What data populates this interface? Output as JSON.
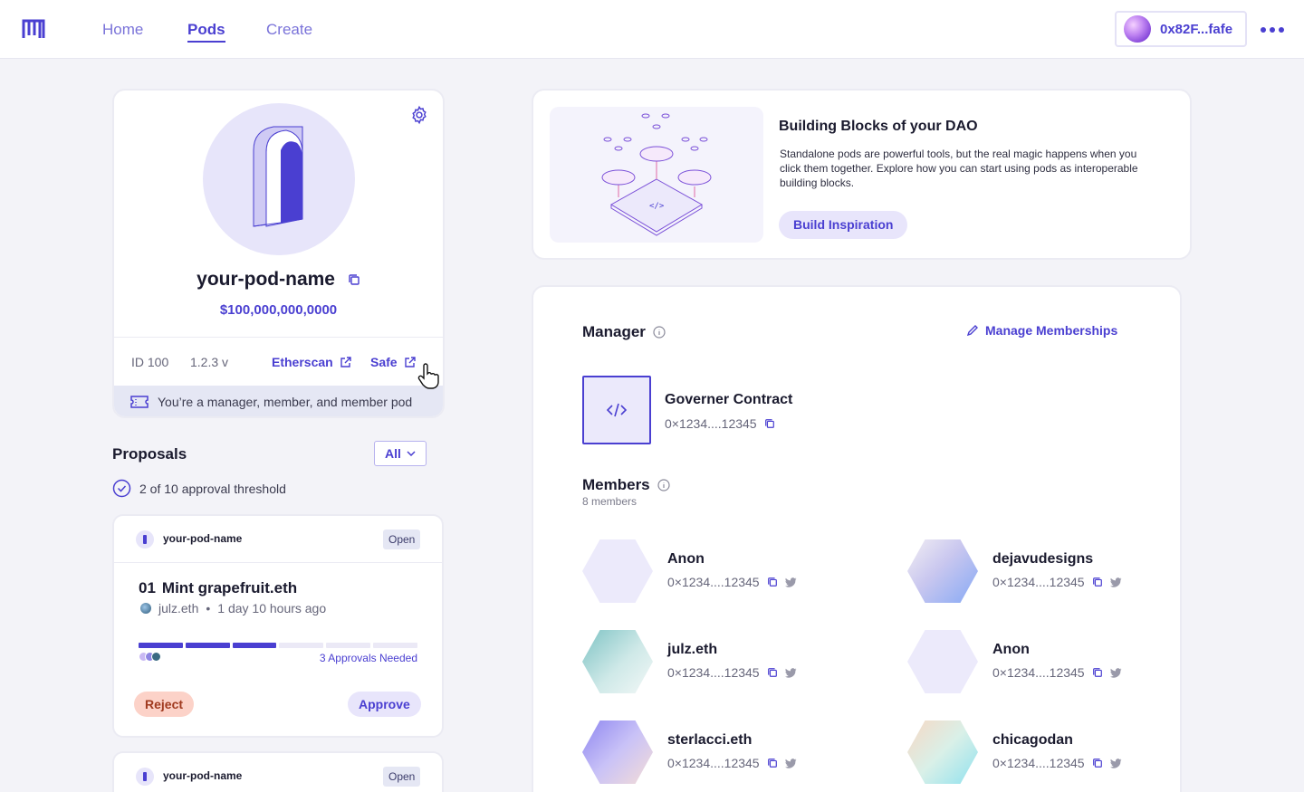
{
  "nav": {
    "links": [
      "Home",
      "Pods",
      "Create"
    ],
    "active": "Pods",
    "wallet_address": "0x82F...fafe"
  },
  "pod": {
    "name": "your-pod-name",
    "value": "$100,000,000,0000",
    "id_label": "ID 100",
    "version": "1.2.3 v",
    "etherscan_label": "Etherscan",
    "safe_label": "Safe",
    "role_text": "You’re a manager, member, and member pod"
  },
  "proposals": {
    "title": "Proposals",
    "filter_value": "All",
    "threshold_text": "2 of 10 approval threshold",
    "items": [
      {
        "pod_name": "your-pod-name",
        "status": "Open",
        "number": "01",
        "title": "Mint grapefruit.eth",
        "author": "julz.eth",
        "time_ago": "1 day 10 hours ago",
        "approvals_needed": "3 Approvals Needed",
        "progress_filled": 3,
        "progress_total": 6,
        "reject_label": "Reject",
        "approve_label": "Approve"
      },
      {
        "pod_name": "your-pod-name",
        "status": "Open"
      }
    ]
  },
  "blocks": {
    "title": "Building Blocks of your DAO",
    "description": "Standalone pods are powerful tools, but the real magic happens when you click them together. Explore how you can start using pods as interoperable building blocks.",
    "button_label": "Build Inspiration"
  },
  "manager": {
    "title": "Manager",
    "manage_label": "Manage Memberships",
    "contract_name": "Governer Contract",
    "contract_address": "0×1234....12345"
  },
  "members": {
    "title": "Members",
    "count_text": "8 members",
    "items": [
      {
        "name": "Anon",
        "address": "0×1234....12345"
      },
      {
        "name": "dejavudesigns",
        "address": "0×1234....12345"
      },
      {
        "name": "julz.eth",
        "address": "0×1234....12345"
      },
      {
        "name": "Anon",
        "address": "0×1234....12345"
      },
      {
        "name": "sterlacci.eth",
        "address": "0×1234....12345"
      },
      {
        "name": "chicagodan",
        "address": "0×1234....12345"
      }
    ]
  },
  "colors": {
    "accent": "#4a3fd1",
    "reject_bg": "#fcd2c8",
    "page_bg": "#f3f3f8"
  }
}
